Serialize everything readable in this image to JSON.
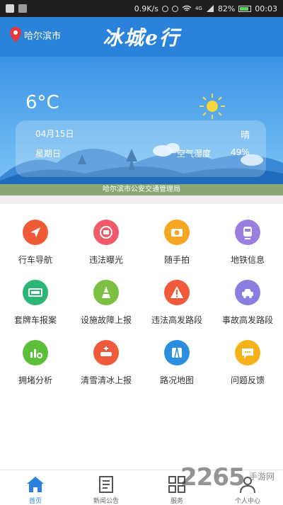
{
  "status_bar": {
    "net_speed": "0.9K/s",
    "signal": "4G",
    "battery": "82%",
    "battery_level": 0.82,
    "time": "00:03"
  },
  "header": {
    "location": "哈尔滨市",
    "title": "冰城e行",
    "brand_color": "#2b82da"
  },
  "weather": {
    "temperature": "6°C",
    "date": "04月15日",
    "condition": "晴",
    "weekday": "星期日",
    "humidity_label": "空气湿度",
    "humidity_value": "49%",
    "agency": "哈尔滨市公安交通管理局"
  },
  "services": [
    {
      "label": "行车导航",
      "icon": "navigation-arrow-icon",
      "color": "#ef5b3a"
    },
    {
      "label": "违法曝光",
      "icon": "violation-icon",
      "color": "#f05b6b"
    },
    {
      "label": "随手拍",
      "icon": "camera-icon",
      "color": "#f5a623"
    },
    {
      "label": "地铁信息",
      "icon": "subway-icon",
      "color": "#9b7fe0"
    },
    {
      "label": "套牌车报案",
      "icon": "license-plate-icon",
      "color": "#2bb673"
    },
    {
      "label": "设施故障上报",
      "icon": "traffic-cone-icon",
      "color": "#7bc043"
    },
    {
      "label": "违法高发路段",
      "icon": "warning-icon",
      "color": "#ef5b3a"
    },
    {
      "label": "事故高发路段",
      "icon": "car-accident-icon",
      "color": "#8a7ee0"
    },
    {
      "label": "拥堵分析",
      "icon": "chart-analysis-icon",
      "color": "#5cbf3a"
    },
    {
      "label": "清雪清冰上报",
      "icon": "snow-car-icon",
      "color": "#ef5b3a"
    },
    {
      "label": "路况地图",
      "icon": "road-map-icon",
      "color": "#2b8fe0"
    },
    {
      "label": "问题反馈",
      "icon": "feedback-chat-icon",
      "color": "#f5b21b"
    }
  ],
  "nav": [
    {
      "label": "首页",
      "icon": "home-icon",
      "active": true
    },
    {
      "label": "新闻公告",
      "icon": "news-icon",
      "active": false
    },
    {
      "label": "服务",
      "icon": "services-grid-icon",
      "active": false
    },
    {
      "label": "个人中心",
      "icon": "person-icon",
      "active": false
    }
  ],
  "watermark": {
    "text": "2265",
    "sub": "手游网"
  }
}
